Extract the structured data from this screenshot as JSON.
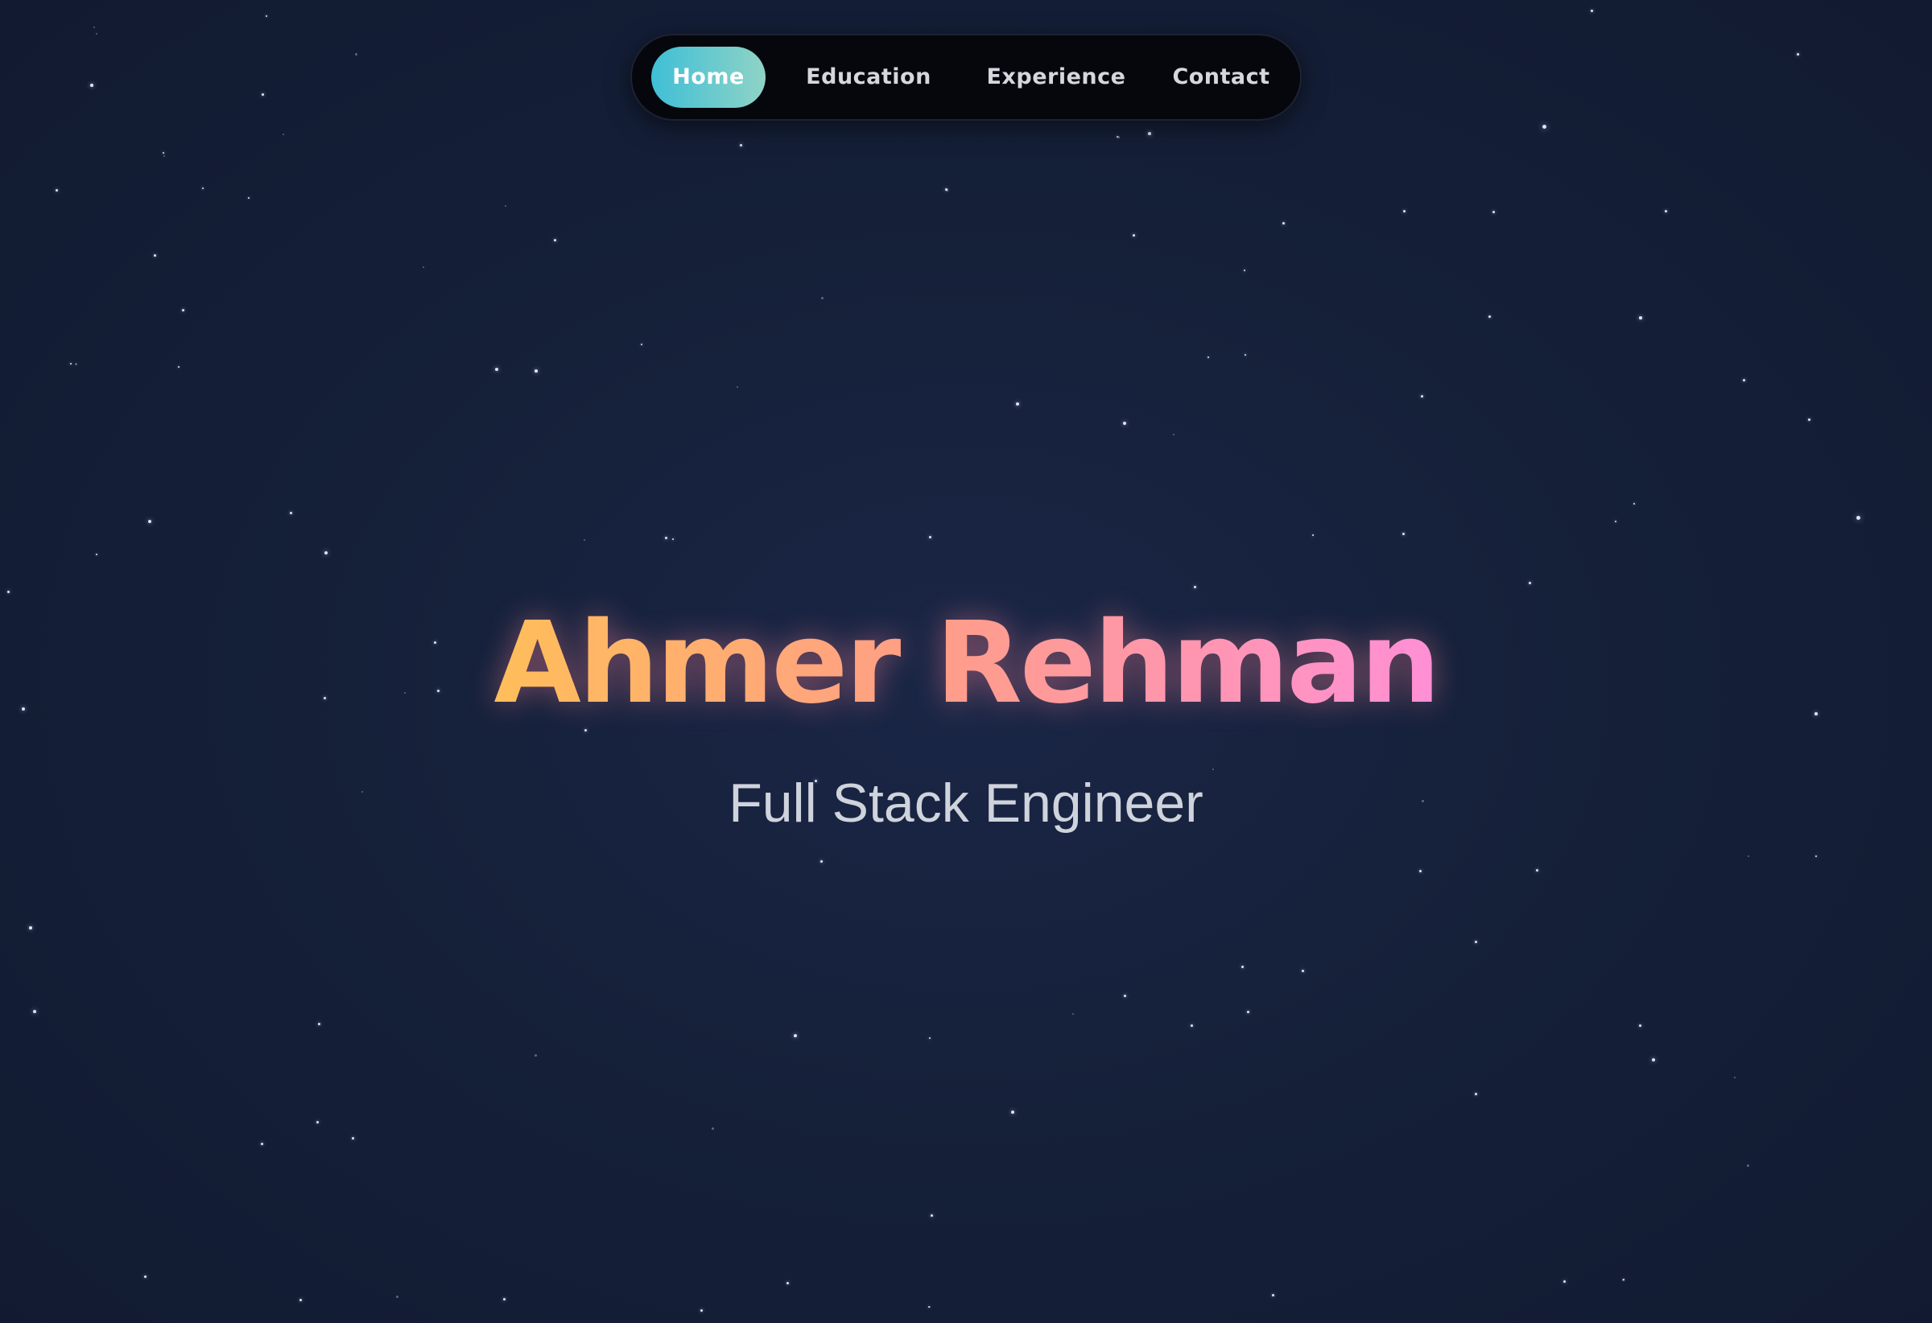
{
  "nav": {
    "items": [
      {
        "label": "Home",
        "active": true
      },
      {
        "label": "Education",
        "active": false
      },
      {
        "label": "Experience",
        "active": false
      },
      {
        "label": "Contact",
        "active": false
      }
    ],
    "active_gradient": [
      "#3fbfd6",
      "#8fd3c6"
    ]
  },
  "hero": {
    "name": "Ahmer Rehman",
    "subtitle": "Full Stack Engineer",
    "name_gradient": [
      "#ffbe5a",
      "#ff9e86",
      "#ff8fd6"
    ]
  },
  "colors": {
    "background": "#152039",
    "star": "#e8eefc",
    "nav_background": "#05070c"
  }
}
